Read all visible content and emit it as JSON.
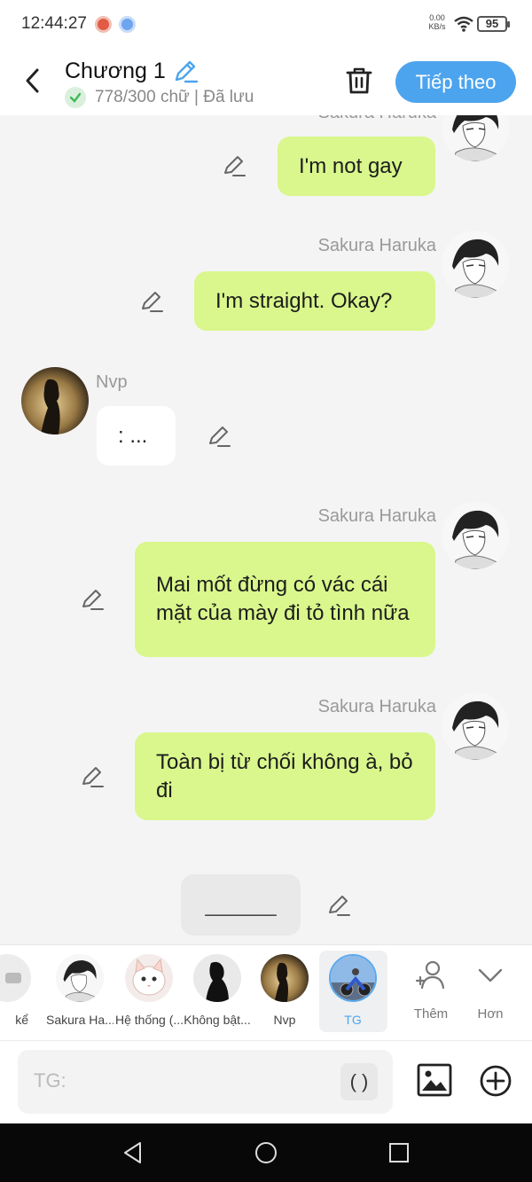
{
  "status_bar": {
    "time": "12:44:27",
    "net_speed_value": "0.00",
    "net_speed_unit": "KB/s",
    "battery": "95"
  },
  "header": {
    "title": "Chương 1",
    "saved_status": "778/300 chữ | Đã lưu",
    "next_label": "Tiếp theo"
  },
  "messages": [
    {
      "side": "right",
      "name": "Sakura Haruka",
      "text": "I'm not gay"
    },
    {
      "side": "right",
      "name": "Sakura Haruka",
      "text": "I'm straight. Okay?"
    },
    {
      "side": "left",
      "name": "Nvp",
      "text": ": ..."
    },
    {
      "side": "right",
      "name": "Sakura Haruka",
      "text": "Mai mốt đừng có vác cái mặt của mày đi tỏ tình nữa"
    },
    {
      "side": "right",
      "name": "Sakura Haruka",
      "text": "Toàn bị từ chối không à, bỏ đi"
    },
    {
      "side": "center",
      "text": "______"
    }
  ],
  "characters": [
    {
      "label": "kể",
      "icon": "narrator-icon"
    },
    {
      "label": "Sakura Ha...",
      "icon": "sakura-avatar"
    },
    {
      "label": "Hệ thống (...",
      "icon": "system-cat-avatar"
    },
    {
      "label": "Không bật...",
      "icon": "silhouette-avatar"
    },
    {
      "label": "Nvp",
      "icon": "nvp-avatar"
    },
    {
      "label": "TG",
      "icon": "tg-avatar",
      "selected": true
    }
  ],
  "tools": {
    "add_label": "Thêm",
    "more_label": "Hơn"
  },
  "input": {
    "placeholder": "TG:",
    "paren_label": "( )"
  },
  "colors": {
    "accent": "#4da4ee",
    "bubble_right": "#d9f78c",
    "bubble_left": "#ffffff",
    "background": "#f4f4f4"
  }
}
